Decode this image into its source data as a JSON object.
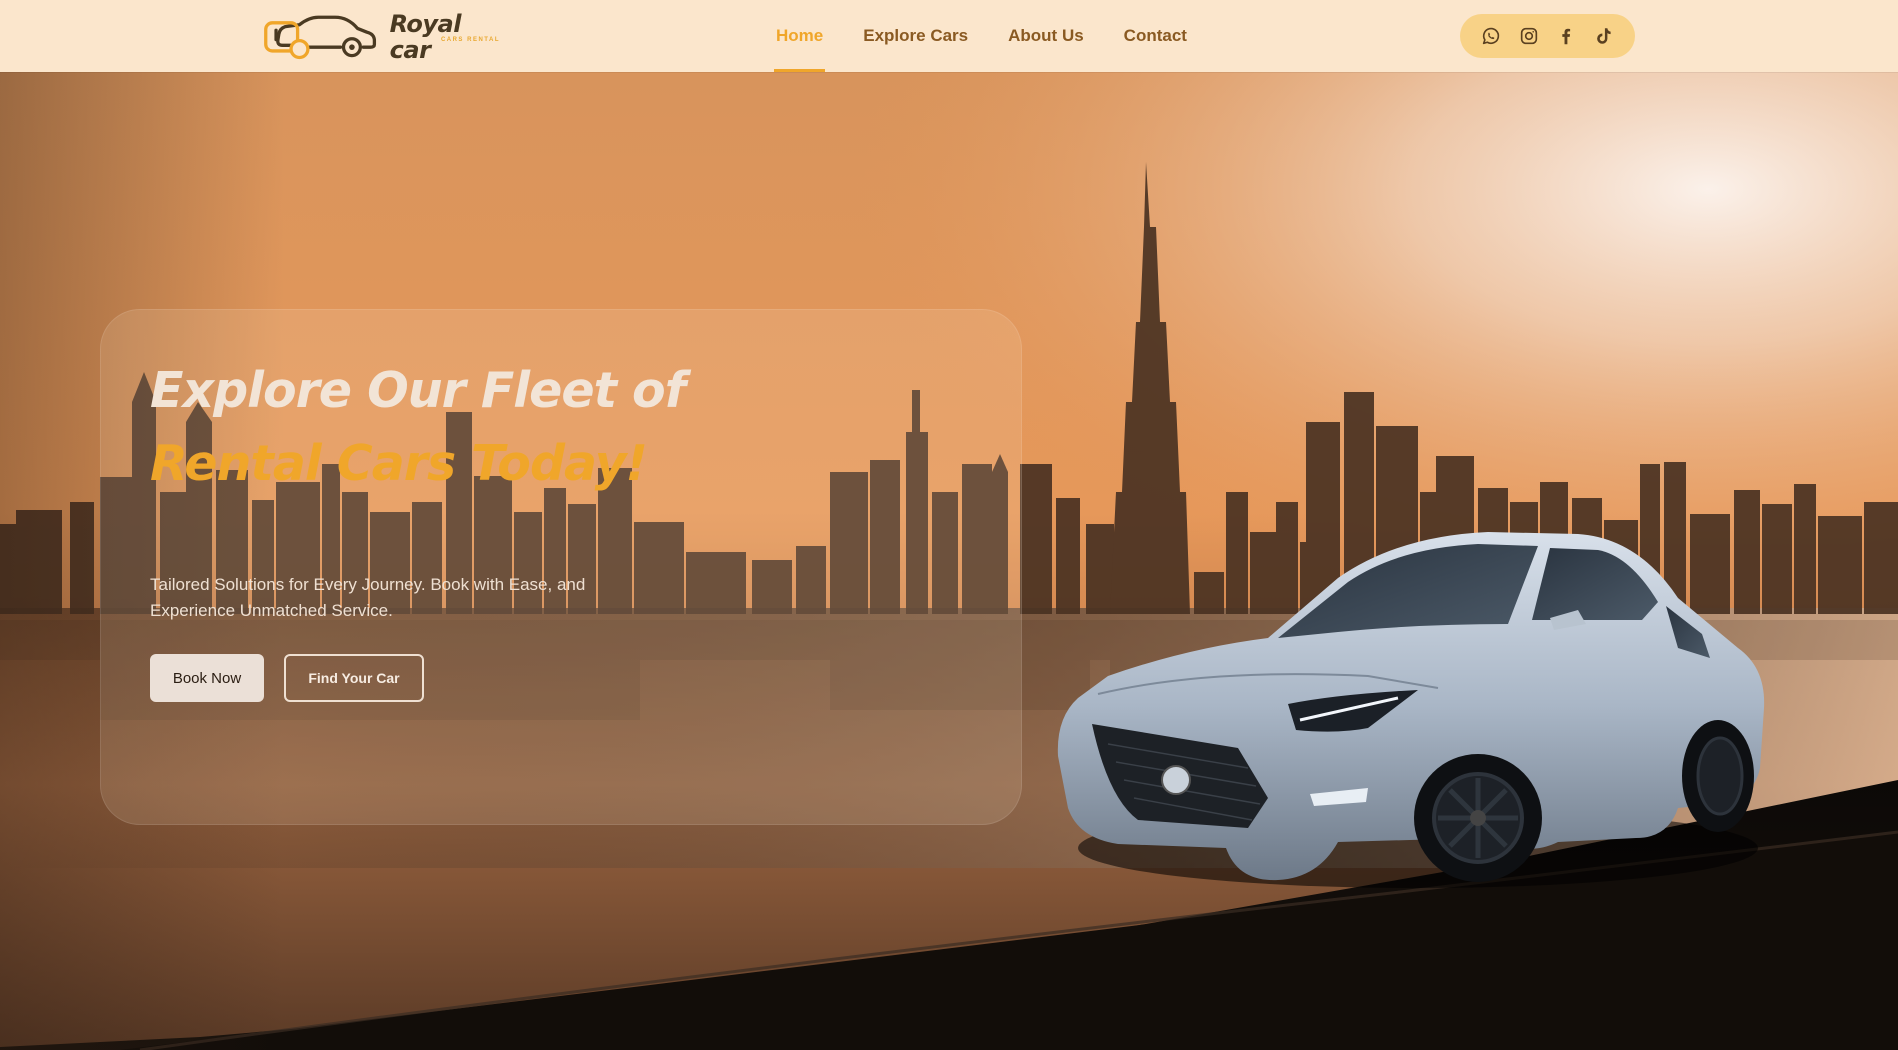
{
  "header": {
    "logo": {
      "name": "Royal car",
      "tagline": "CARS RENTAL"
    },
    "nav": [
      {
        "label": "Home",
        "active": true
      },
      {
        "label": "Explore Cars",
        "active": false
      },
      {
        "label": "About Us",
        "active": false
      },
      {
        "label": "Contact",
        "active": false
      }
    ],
    "social_icons": [
      "whatsapp-icon",
      "instagram-icon",
      "facebook-icon",
      "tiktok-icon"
    ]
  },
  "hero": {
    "title_line1": "Explore Our Fleet of",
    "title_line2": "Rental Cars Today!",
    "subtitle": "Tailored Solutions for Every Journey. Book with Ease, and Experience Unmatched Service.",
    "primary_button": "Book Now",
    "secondary_button": "Find Your Car"
  },
  "colors": {
    "header_bg": "#fbe6cc",
    "accent": "#f0a62a",
    "nav_text": "#8a5a22",
    "social_pill": "#f8d287",
    "sky_top": "#d9945f",
    "skyline": "#4a3222"
  }
}
